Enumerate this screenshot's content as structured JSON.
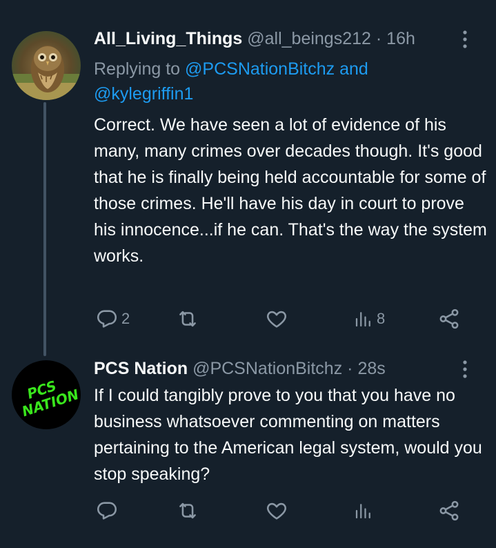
{
  "tweets": [
    {
      "display_name": "All_Living_Things",
      "handle": "@all_beings212",
      "separator": "·",
      "time": "16h",
      "replying_prefix": "Replying to ",
      "replying_mention_1": "@PCSNationBitchz",
      "replying_joiner": " and",
      "replying_mention_2": "@kylegriffin1",
      "text": "Correct. We have seen a lot of evidence of his many, many crimes over decades though. It's good that he is finally being held accountable for some of those crimes. He'll have his day in court to prove his innocence...if he can. That's the way the system works.",
      "reply_count": "2",
      "retweet_count": "",
      "like_count": "",
      "view_count": "8",
      "avatar_icon": "owl-photo-avatar"
    },
    {
      "display_name": "PCS Nation",
      "handle": "@PCSNationBitchz",
      "separator": "·",
      "time": "28s",
      "text": "If I could tangibly prove to you that you have no business whatsoever commenting on matters pertaining to the American legal system, would you stop speaking?",
      "reply_count": "",
      "retweet_count": "",
      "like_count": "",
      "view_count": "",
      "avatar_text": "PCS NATION",
      "avatar_icon": "pcs-nation-logo-avatar"
    }
  ],
  "colors": {
    "background": "#15202b",
    "text_primary": "#f7f9f9",
    "text_secondary": "#8b98a5",
    "link": "#1d9bf0",
    "icon": "#8b98a5",
    "thread_line": "#425364",
    "logo_green": "#39e51c"
  },
  "icons": {
    "reply": "reply-bubble-icon",
    "retweet": "retweet-icon",
    "like": "heart-icon",
    "views": "views-bar-chart-icon",
    "share": "share-icon",
    "more": "more-dots-icon"
  }
}
